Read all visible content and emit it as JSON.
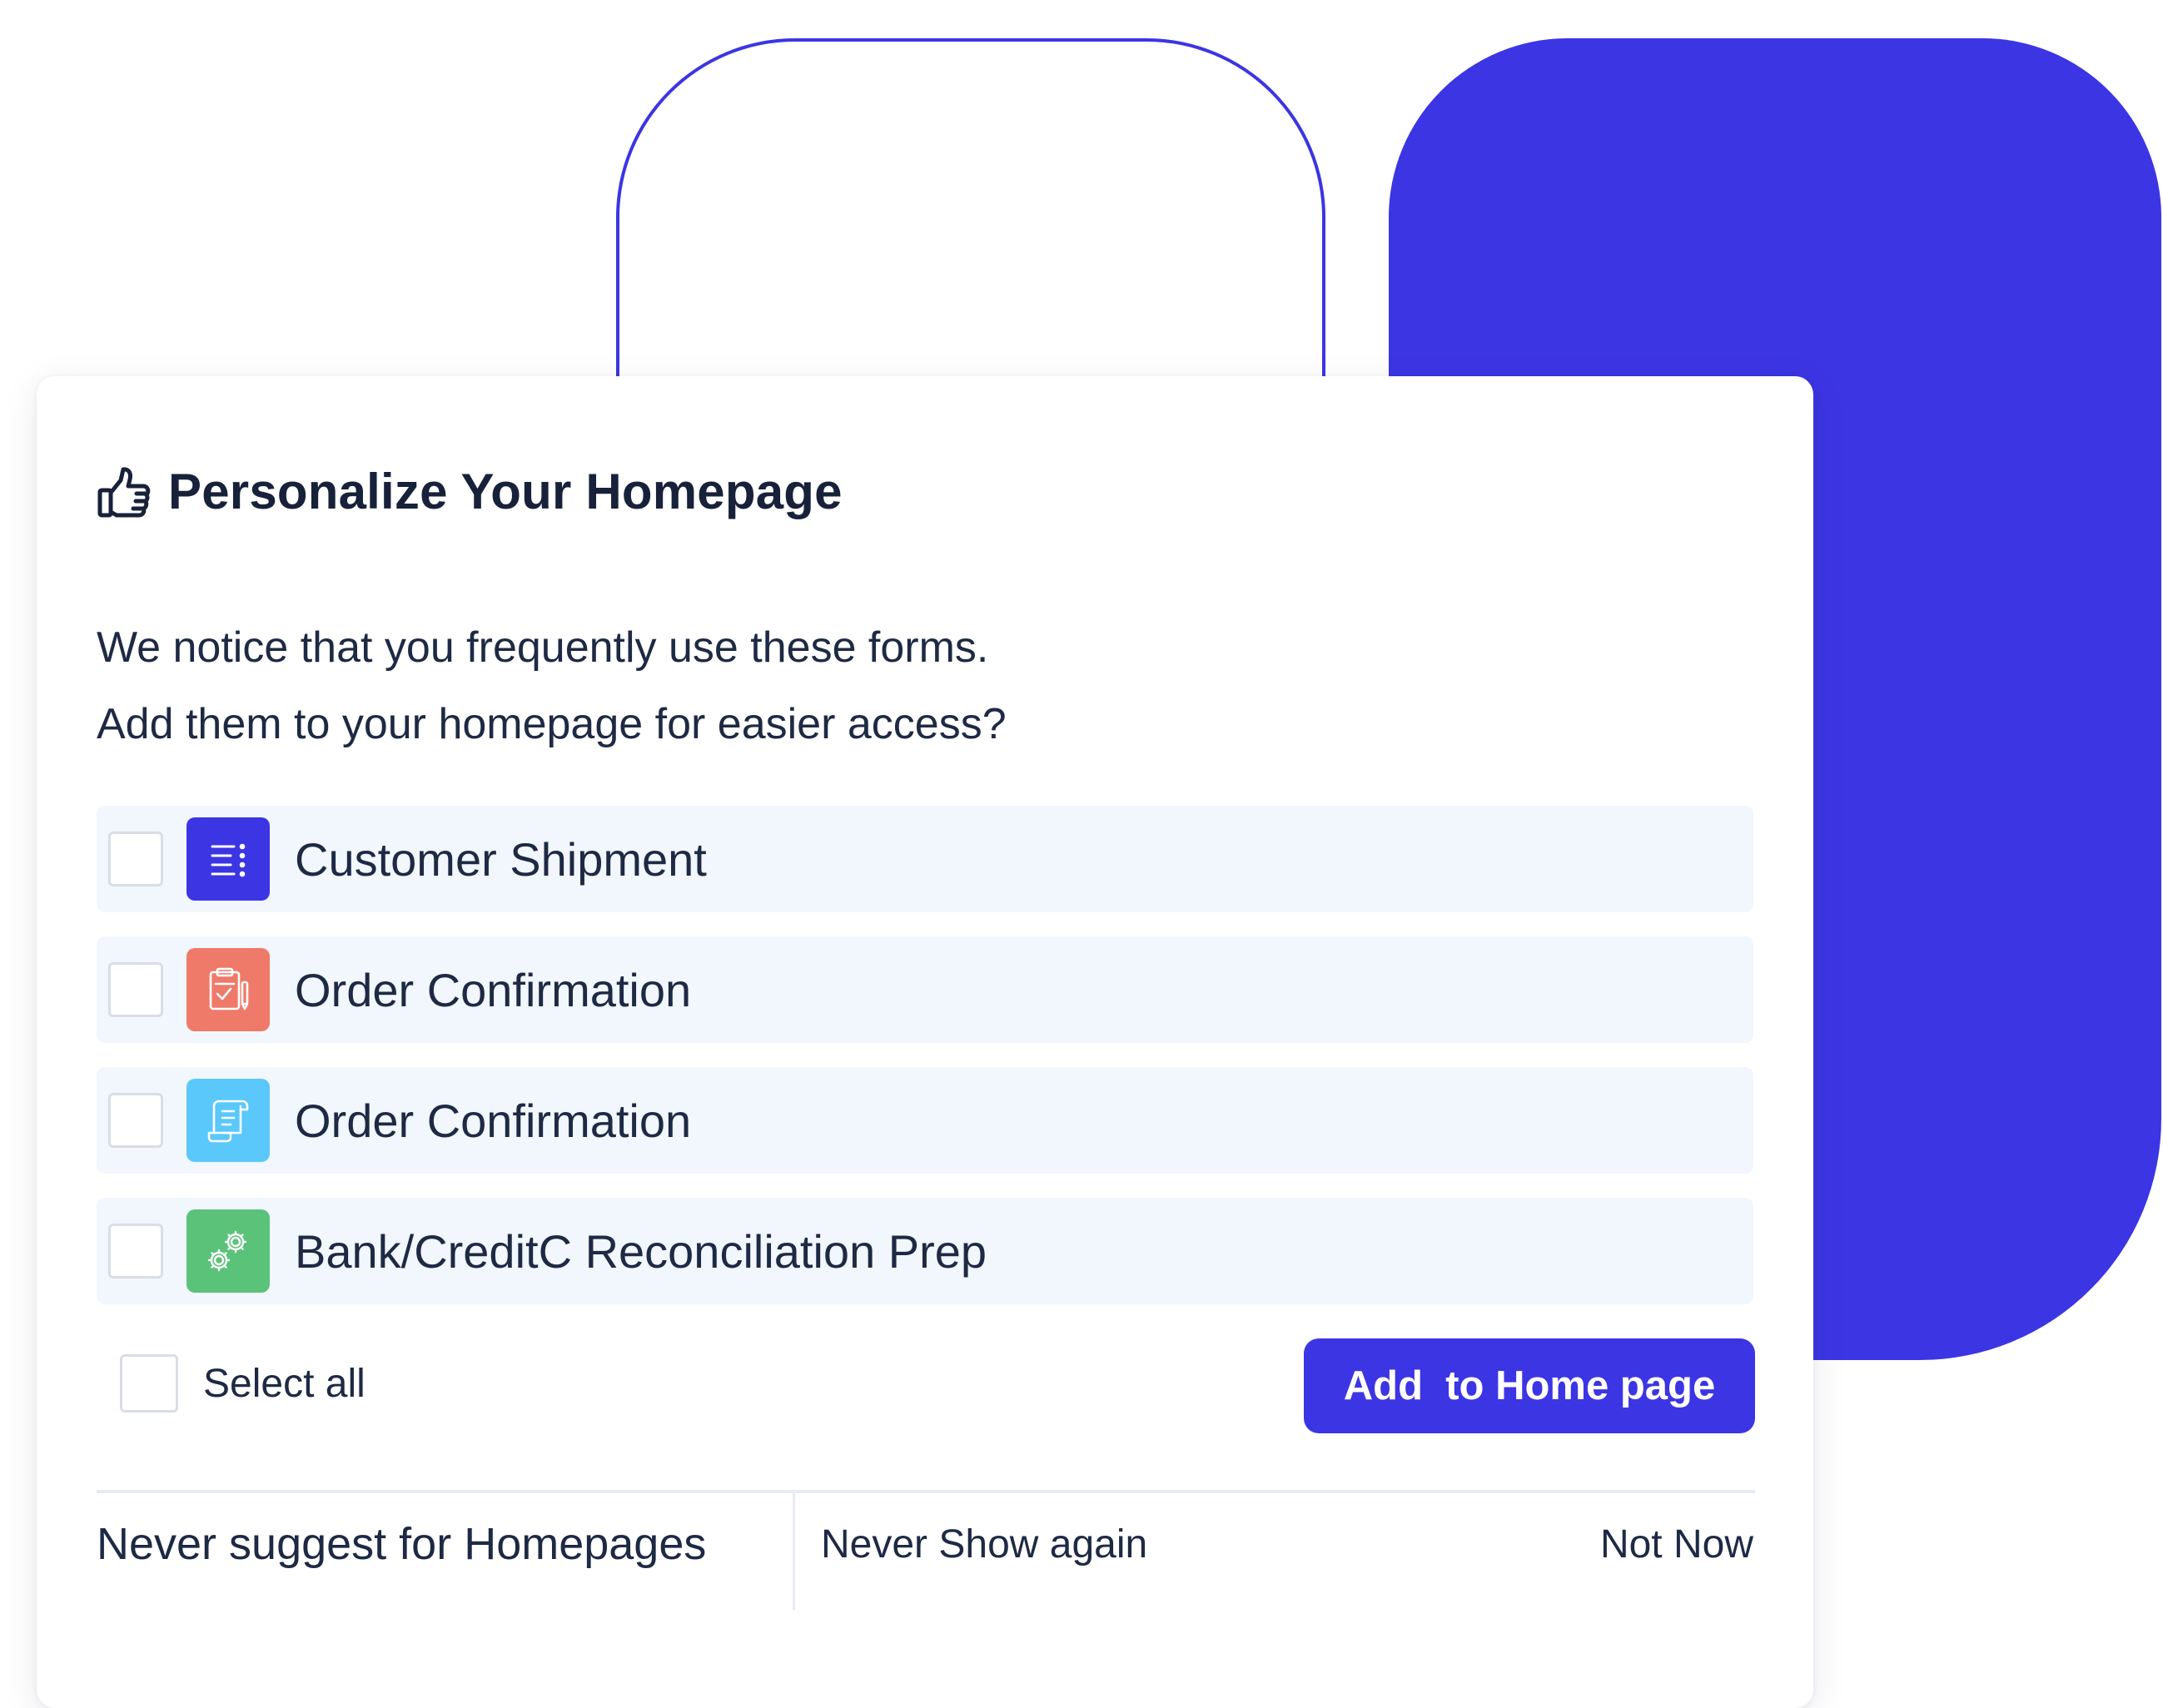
{
  "dialog": {
    "title": "Personalize Your Homepage",
    "title_icon": "thumbs-up-icon",
    "description_line1": "We notice that you frequently use these forms.",
    "description_line2": "Add them to your homepage for easier access?"
  },
  "forms": [
    {
      "label": "Customer Shipment",
      "icon": "list-icon",
      "color": "#3c35e3",
      "checked": false
    },
    {
      "label": "Order Confirmation",
      "icon": "clipboard-check-icon",
      "color": "#ef7a6a",
      "checked": false
    },
    {
      "label": "Order Confirmation",
      "icon": "scroll-document-icon",
      "color": "#5ac8fa",
      "checked": false
    },
    {
      "label": "Bank/CreditC Reconciliation Prep",
      "icon": "gears-icon",
      "color": "#5bc27a",
      "checked": false
    }
  ],
  "select_all": {
    "label": "Select all",
    "checked": false
  },
  "actions": {
    "add_label": "Add  to Home page",
    "never_suggest_label": "Never suggest for Homepages",
    "never_show_label": "Never Show again",
    "not_now_label": "Not Now"
  },
  "colors": {
    "accent": "#3c35e3",
    "row_background": "#f2f6fd",
    "text": "#1e2a44"
  }
}
